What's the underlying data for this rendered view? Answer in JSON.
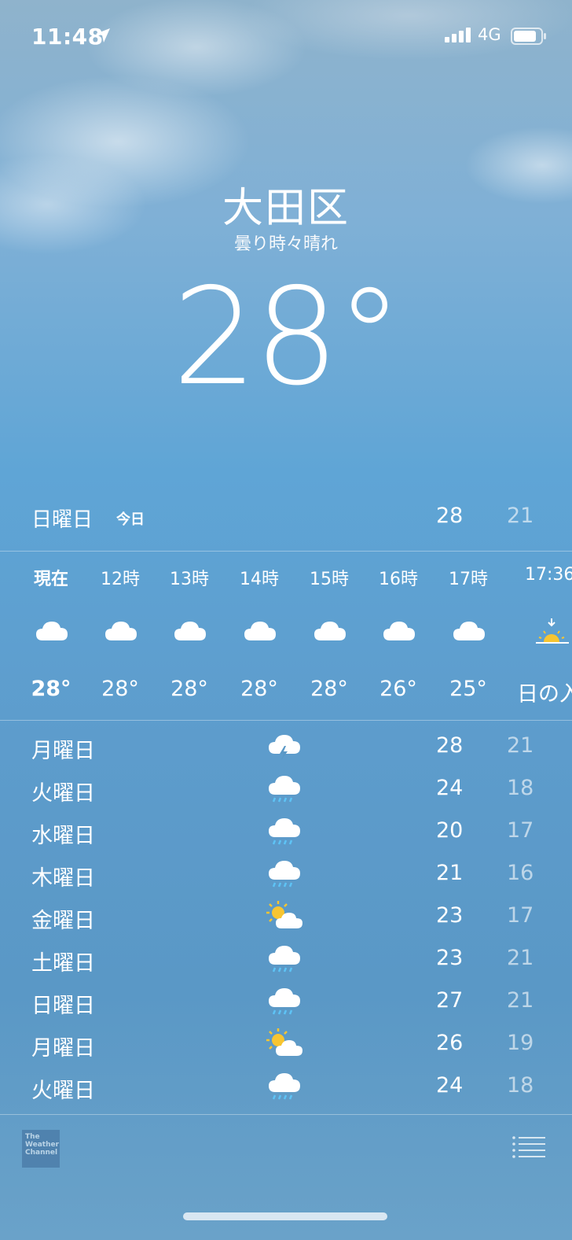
{
  "status_bar": {
    "time": "11:48",
    "network": "4G",
    "location_icon": "location-arrow-icon",
    "signal_icon": "cellular-signal-icon",
    "battery_icon": "battery-icon"
  },
  "header": {
    "city": "大田区",
    "condition": "曇り時々晴れ",
    "temperature": "28°"
  },
  "today": {
    "day": "日曜日",
    "tag": "今日",
    "high": "28",
    "low": "21"
  },
  "hourly": [
    {
      "time": "現在",
      "icon": "cloud-icon",
      "temp": "28°",
      "bold": true
    },
    {
      "time": "12時",
      "icon": "cloud-icon",
      "temp": "28°"
    },
    {
      "time": "13時",
      "icon": "cloud-icon",
      "temp": "28°"
    },
    {
      "time": "14時",
      "icon": "cloud-icon",
      "temp": "28°"
    },
    {
      "time": "15時",
      "icon": "cloud-icon",
      "temp": "28°"
    },
    {
      "time": "16時",
      "icon": "cloud-icon",
      "temp": "26°"
    },
    {
      "time": "17時",
      "icon": "cloud-icon",
      "temp": "25°"
    },
    {
      "time": "17:36",
      "icon": "sunset-icon",
      "temp": "日の入"
    }
  ],
  "daily": [
    {
      "day": "月曜日",
      "icon": "thunderstorm-icon",
      "high": "28",
      "low": "21"
    },
    {
      "day": "火曜日",
      "icon": "rain-icon",
      "high": "24",
      "low": "18"
    },
    {
      "day": "水曜日",
      "icon": "rain-icon",
      "high": "20",
      "low": "17"
    },
    {
      "day": "木曜日",
      "icon": "rain-icon",
      "high": "21",
      "low": "16"
    },
    {
      "day": "金曜日",
      "icon": "partly-cloudy-icon",
      "high": "23",
      "low": "17"
    },
    {
      "day": "土曜日",
      "icon": "rain-icon",
      "high": "23",
      "low": "21"
    },
    {
      "day": "日曜日",
      "icon": "rain-icon",
      "high": "27",
      "low": "21"
    },
    {
      "day": "月曜日",
      "icon": "partly-cloudy-icon",
      "high": "26",
      "low": "19"
    },
    {
      "day": "火曜日",
      "icon": "rain-icon",
      "high": "24",
      "low": "18"
    }
  ],
  "footer": {
    "logo_text": "The Weather Channel",
    "list_icon": "list-icon"
  },
  "colors": {
    "sun": "#f7c531",
    "rain": "#5ec3f5",
    "text": "#ffffff"
  }
}
